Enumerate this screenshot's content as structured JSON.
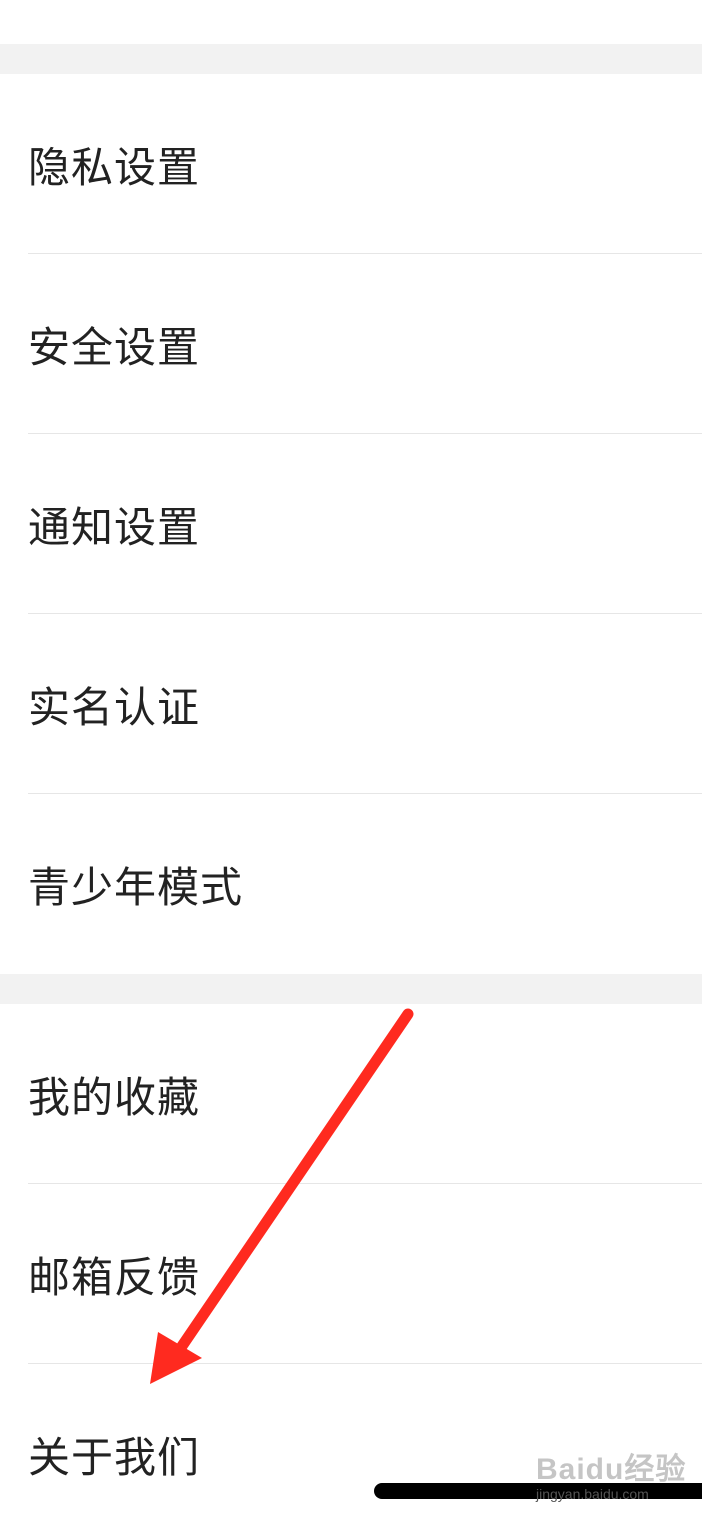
{
  "group1": {
    "items": [
      {
        "label": "隐私设置"
      },
      {
        "label": "安全设置"
      },
      {
        "label": "通知设置"
      },
      {
        "label": "实名认证"
      },
      {
        "label": "青少年模式"
      }
    ]
  },
  "group2": {
    "items": [
      {
        "label": "我的收藏"
      },
      {
        "label": "邮箱反馈"
      },
      {
        "label": "关于我们"
      }
    ]
  },
  "watermark": {
    "logo_text": "Baidu经验",
    "domain": "jingyan.baidu.com"
  },
  "colors": {
    "arrow": "#ff2a1f",
    "group_gap": "#f2f2f2",
    "divider": "#e6e6e6"
  }
}
